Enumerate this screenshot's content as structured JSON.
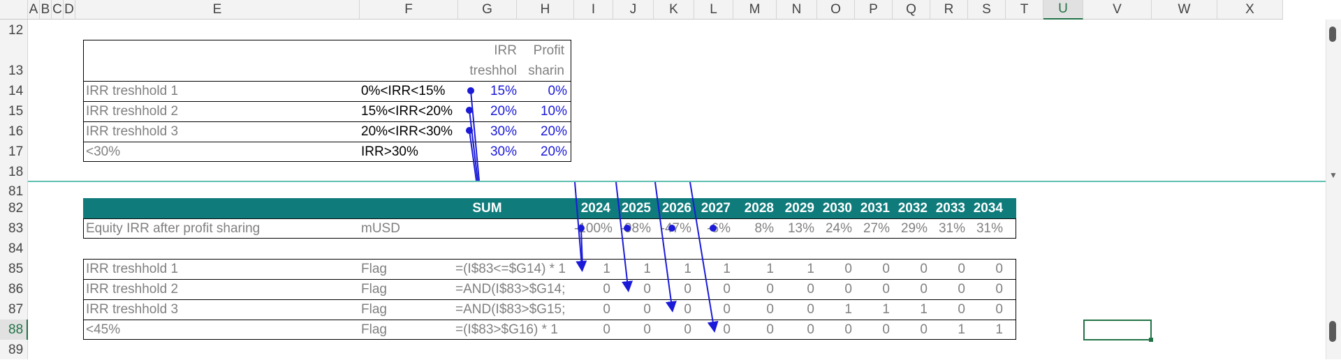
{
  "columns": [
    "A",
    "B",
    "C",
    "D",
    "E",
    "F",
    "G",
    "H",
    "I",
    "J",
    "K",
    "L",
    "M",
    "N",
    "O",
    "P",
    "Q",
    "R",
    "S",
    "T",
    "U",
    "V",
    "W",
    "X"
  ],
  "selected_column": "U",
  "rows": [
    "12",
    "13",
    "14",
    "15",
    "16",
    "17",
    "18",
    "81",
    "82",
    "83",
    "84",
    "85",
    "86",
    "87",
    "88",
    "89"
  ],
  "selected_row": "88",
  "top_table": {
    "hdr_g1": "IRR",
    "hdr_g2": "treshhol",
    "hdr_h1": "Profit",
    "hdr_h2": "sharin",
    "rows": [
      {
        "label": "IRR treshhold 1",
        "range": "0%<IRR<15%",
        "threshold": "15%",
        "share": "0%"
      },
      {
        "label": "IRR treshhold 2",
        "range": "15%<IRR<20%",
        "threshold": "20%",
        "share": "10%"
      },
      {
        "label": "IRR treshhold 3",
        "range": "20%<IRR<30%",
        "threshold": "30%",
        "share": "20%"
      },
      {
        "label": "<30%",
        "range": "IRR>30%",
        "threshold": "30%",
        "share": "20%"
      }
    ]
  },
  "bottom_table": {
    "sum_label": "SUM",
    "years": [
      "2024",
      "2025",
      "2026",
      "2027",
      "2028",
      "2029",
      "2030",
      "2031",
      "2032",
      "2033",
      "2034"
    ],
    "irr_row": {
      "label": "Equity IRR after profit sharing",
      "unit": "mUSD",
      "values": [
        "-100%",
        "-98%",
        "-47%",
        "-6%",
        "8%",
        "13%",
        "24%",
        "27%",
        "29%",
        "31%",
        "31%"
      ]
    },
    "flag_rows": [
      {
        "label": "IRR treshhold 1",
        "unit": "Flag",
        "formula": "=(I$83<=$G14) * 1",
        "values": [
          "1",
          "1",
          "1",
          "1",
          "1",
          "1",
          "0",
          "0",
          "0",
          "0",
          "0"
        ]
      },
      {
        "label": "IRR treshhold 2",
        "unit": "Flag",
        "formula": "=AND(I$83>$G14;",
        "values": [
          "0",
          "0",
          "0",
          "0",
          "0",
          "0",
          "0",
          "0",
          "0",
          "0",
          "0"
        ]
      },
      {
        "label": "IRR treshhold 3",
        "unit": "Flag",
        "formula": "=AND(I$83>$G15;",
        "values": [
          "0",
          "0",
          "0",
          "0",
          "0",
          "0",
          "1",
          "1",
          "1",
          "0",
          "0"
        ]
      },
      {
        "label": "<45%",
        "unit": "Flag",
        "formula": "=(I$83>$G16) * 1",
        "values": [
          "0",
          "0",
          "0",
          "0",
          "0",
          "0",
          "0",
          "0",
          "0",
          "1",
          "1"
        ]
      }
    ]
  },
  "colors": {
    "header_teal": "#0f7b7b",
    "trace_blue": "#1a1ad8",
    "selection_green": "#217346"
  }
}
